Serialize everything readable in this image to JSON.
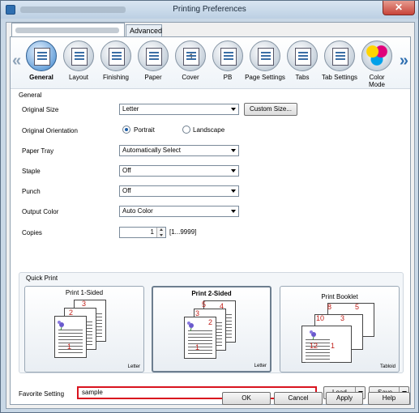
{
  "window": {
    "title": "Printing Preferences",
    "close": "✕"
  },
  "tabs": [
    {
      "label": ""
    },
    {
      "label": "Advanced"
    }
  ],
  "ribbon": {
    "items": [
      {
        "label": "General"
      },
      {
        "label": "Layout"
      },
      {
        "label": "Finishing"
      },
      {
        "label": "Paper"
      },
      {
        "label": "Cover"
      },
      {
        "label": "PB"
      },
      {
        "label": "Page Settings"
      },
      {
        "label": "Tabs"
      },
      {
        "label": "Tab Settings"
      },
      {
        "label": "Color Mode"
      }
    ],
    "cover_digit": "1"
  },
  "general": {
    "group_title": "General",
    "original_size": {
      "label": "Original Size",
      "value": "Letter",
      "custom_button": "Custom Size..."
    },
    "orientation": {
      "label": "Original Orientation",
      "portrait": "Portrait",
      "landscape": "Landscape"
    },
    "paper_tray": {
      "label": "Paper Tray",
      "value": "Automatically Select"
    },
    "staple": {
      "label": "Staple",
      "value": "Off"
    },
    "punch": {
      "label": "Punch",
      "value": "Off"
    },
    "output_color": {
      "label": "Output Color",
      "value": "Auto Color"
    },
    "copies": {
      "label": "Copies",
      "value": "1",
      "range": "[1...9999]"
    }
  },
  "quick_print": {
    "title": "Quick Print",
    "cards": [
      {
        "title": "Print 1-Sided",
        "size": "Letter",
        "pages": [
          "3",
          "2",
          "1"
        ]
      },
      {
        "title": "Print 2-Sided",
        "size": "Letter",
        "pages": [
          "5",
          "4",
          "3",
          "2",
          "1"
        ]
      },
      {
        "title": "Print Booklet",
        "size": "Tabloid",
        "pages": [
          "8",
          "5",
          "10",
          "3",
          "12",
          "1"
        ]
      }
    ]
  },
  "favorite": {
    "label": "Favorite Setting",
    "value": "sample",
    "load": "Load",
    "save": "Save"
  },
  "footer": {
    "ok": "OK",
    "cancel": "Cancel",
    "apply": "Apply",
    "help": "Help"
  }
}
